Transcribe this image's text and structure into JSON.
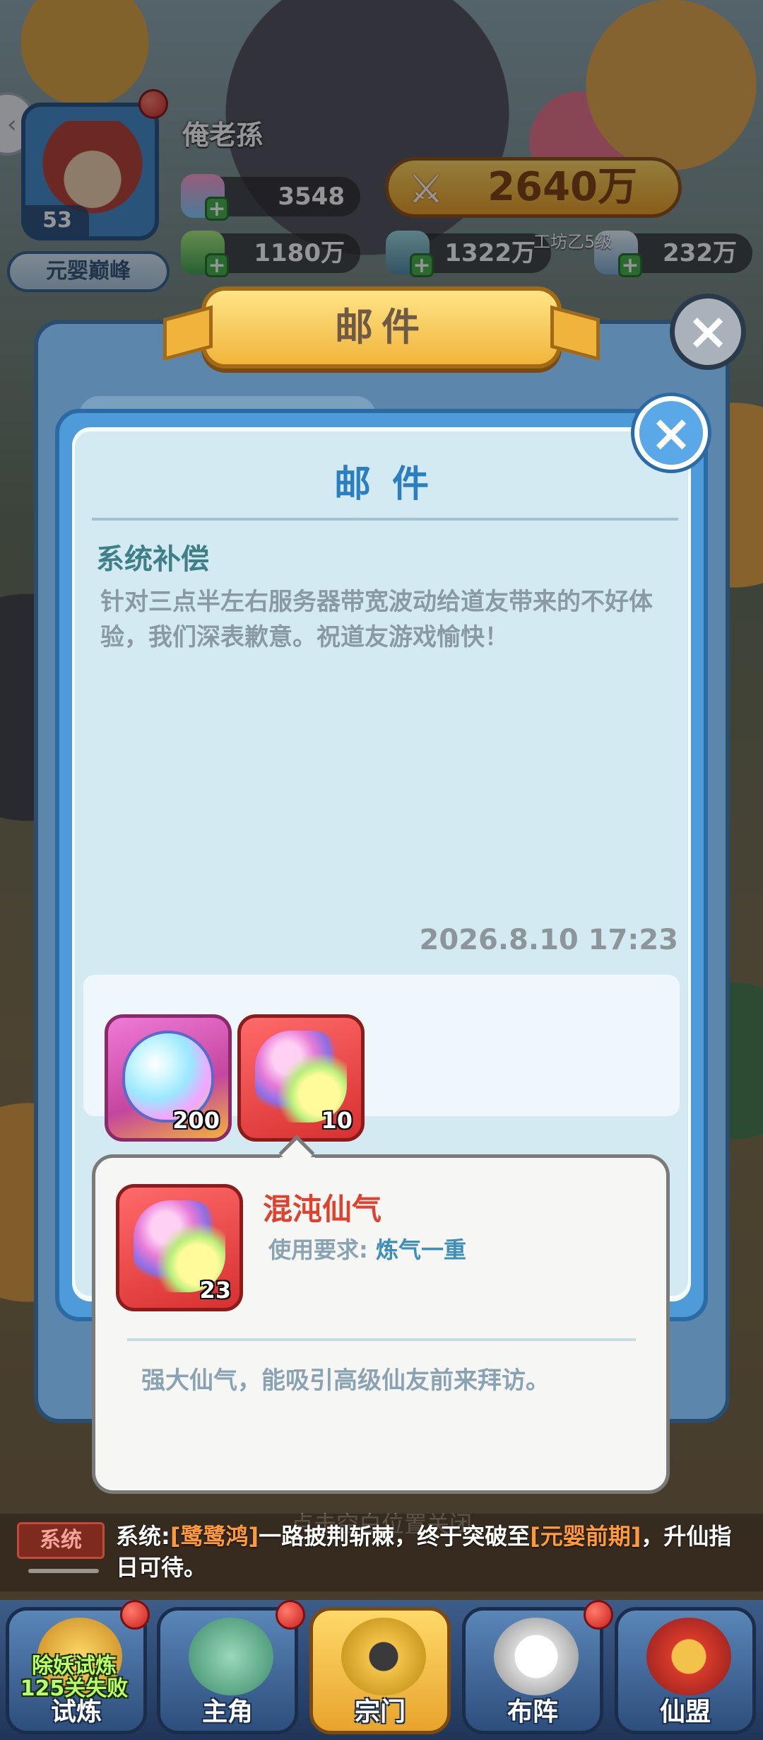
{
  "player": {
    "name": "俺老孫",
    "level": "53",
    "realm": "元婴巅峰"
  },
  "resources": {
    "gem": "3548",
    "power": "2640万",
    "herb": "1180万",
    "ore": "1322万",
    "crystal": "232万",
    "workshop_label": "工坊乙5级"
  },
  "outer_panel": {
    "title": "邮件"
  },
  "mail": {
    "heading": "邮件",
    "subject": "系统补偿",
    "body": "针对三点半左右服务器带宽波动给道友带来的不好体验，我们深表歉意。祝道友游戏愉快！",
    "date": "2026.8.10 17:23",
    "attachments": [
      {
        "name": "apple-item",
        "count": "200"
      },
      {
        "name": "chaos-essence-item",
        "count": "10"
      }
    ]
  },
  "tooltip": {
    "item_name": "混沌仙气",
    "count": "23",
    "req_label": "使用要求:",
    "req_value": "炼气一重",
    "description": "强大仙气，能吸引高级仙友前来拜访。"
  },
  "hint": "点击空白位置关闭",
  "system_message": {
    "tag": "系统",
    "prefix": "系统:",
    "player": "[鹭鹭鸿]",
    "text": "一路披荆斩棘，终于突破至",
    "realm": "[元婴前期]",
    "suffix": "，升仙指日可待。"
  },
  "nav": {
    "trial_banner": "除妖试炼 125关失败",
    "items": [
      "试炼",
      "主角",
      "宗门",
      "布阵",
      "仙盟"
    ]
  },
  "colors": {
    "mail_heading": "#2c7fbf",
    "item_name": "#e0402c",
    "highlight": "#ff9a3a"
  }
}
